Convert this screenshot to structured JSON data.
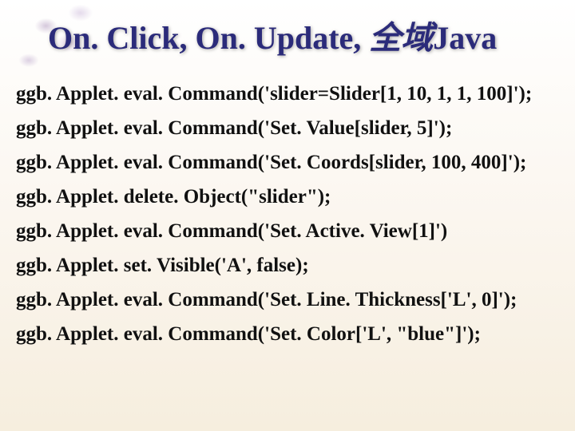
{
  "slide": {
    "title_en_prefix": "On. Click, On. Update, ",
    "title_cjk": "全域",
    "title_en_suffix": "Java",
    "code_lines": [
      "ggb. Applet. eval. Command('slider=Slider[1, 10, 1, 1, 100]');",
      "ggb. Applet. eval. Command('Set. Value[slider, 5]');",
      "ggb. Applet. eval. Command('Set. Coords[slider, 100, 400]');",
      "ggb. Applet. delete. Object(\"slider\");",
      "ggb. Applet. eval. Command('Set. Active. View[1]')",
      "ggb. Applet. set. Visible('A', false);",
      "ggb. Applet. eval. Command('Set. Line. Thickness['L', 0]');",
      "ggb. Applet. eval. Command('Set. Color['L', \"blue\"]');"
    ]
  }
}
